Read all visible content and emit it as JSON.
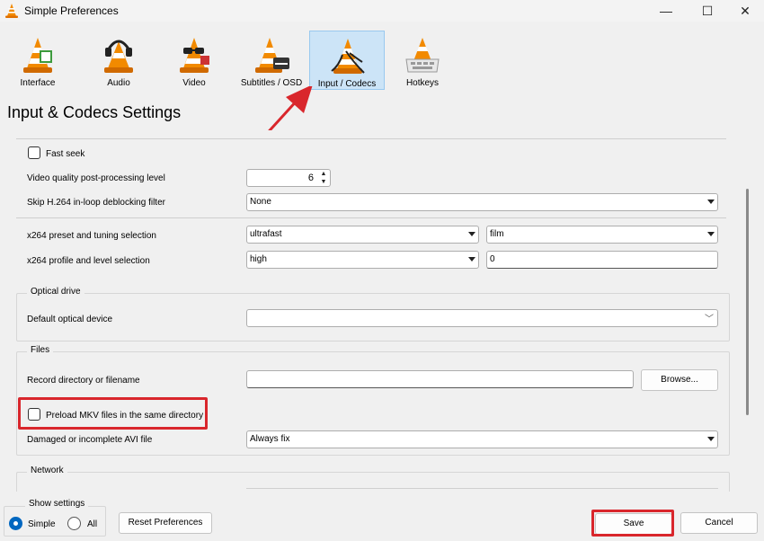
{
  "window": {
    "title": "Simple Preferences",
    "controls": {
      "minimize": "—",
      "maximize": "☐",
      "close": "✕"
    }
  },
  "categories": [
    {
      "label": "Interface",
      "icon": "vlc-cone-interface-icon",
      "selected": false
    },
    {
      "label": "Audio",
      "icon": "vlc-cone-headphones-icon",
      "selected": false
    },
    {
      "label": "Video",
      "icon": "vlc-cone-sunglasses-icon",
      "selected": false
    },
    {
      "label": "Subtitles / OSD",
      "icon": "vlc-cone-subtitles-icon",
      "selected": false
    },
    {
      "label": "Input / Codecs",
      "icon": "vlc-cone-cables-icon",
      "selected": true
    },
    {
      "label": "Hotkeys",
      "icon": "vlc-cone-keyboard-icon",
      "selected": false
    }
  ],
  "page_title": "Input & Codecs Settings",
  "codecs": {
    "fast_seek": {
      "label": "Fast seek",
      "checked": false
    },
    "postproc": {
      "label": "Video quality post-processing level",
      "value": "6"
    },
    "skip_h264": {
      "label": "Skip H.264 in-loop deblocking filter",
      "value": "None"
    },
    "x264_preset": {
      "label": "x264 preset and tuning selection",
      "preset": "ultrafast",
      "tuning": "film"
    },
    "x264_profile": {
      "label": "x264 profile and level selection",
      "profile": "high",
      "level": "0"
    }
  },
  "optical": {
    "group_title": "Optical drive",
    "device_label": "Default optical device",
    "device_value": ""
  },
  "files": {
    "group_title": "Files",
    "record_label": "Record directory or filename",
    "record_value": "",
    "browse_label": "Browse...",
    "preload_mkv_label": "Preload MKV files in the same directory",
    "preload_mkv_checked": false,
    "avi_label": "Damaged or incomplete AVI file",
    "avi_value": "Always fix"
  },
  "network": {
    "group_title": "Network"
  },
  "show_settings": {
    "group_title": "Show settings",
    "simple_label": "Simple",
    "all_label": "All",
    "selected": "simple"
  },
  "buttons": {
    "reset": "Reset Preferences",
    "save": "Save",
    "cancel": "Cancel"
  },
  "colors": {
    "highlight_red": "#d9262c",
    "selected_tab": "#cce4f7",
    "accent_blue": "#0067c0",
    "vlc_orange": "#f28a00"
  }
}
